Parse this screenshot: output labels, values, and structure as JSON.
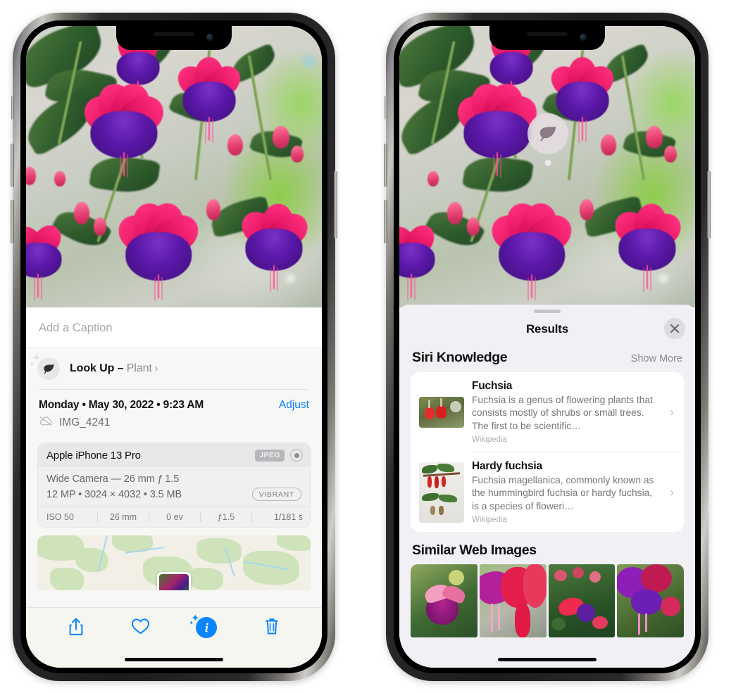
{
  "colors": {
    "accent_blue": "#0a84ff",
    "sheet_gray": "#f1f0f5",
    "card_white": "#ffffff",
    "muted_text": "#8e8e93"
  },
  "left_phone": {
    "name": "photos-detail-screen",
    "caption": {
      "placeholder": "Add a Caption",
      "value": ""
    },
    "lookup": {
      "icon": "leaf-icon",
      "label": "Look Up – ",
      "subject": "Plant",
      "chevron": "›"
    },
    "date": {
      "text": "Monday • May 30, 2022 • 9:23 AM",
      "adjust_label": "Adjust",
      "cloud_icon": "icloud-slash-icon",
      "filename": "IMG_4241"
    },
    "exif": {
      "device": "Apple iPhone 13 Pro",
      "format_badge": "JPEG",
      "hdr_icon": "hdr-ring-icon",
      "lens": "Wide Camera — 26 mm ƒ 1.5",
      "size_line": "12 MP • 3024 × 4032 • 3.5 MB",
      "vibrant_badge": "VIBRANT",
      "stats": [
        "ISO 50",
        "26 mm",
        "0 ev",
        "ƒ1.5",
        "1/181 s"
      ]
    },
    "map": {
      "name": "location-map-thumbnail",
      "pin_label": ""
    },
    "toolbar": [
      {
        "name": "share-button",
        "icon": "share-icon"
      },
      {
        "name": "favorite-button",
        "icon": "heart-icon"
      },
      {
        "name": "info-button",
        "icon": "info-sparkle-icon",
        "glyph": "i"
      },
      {
        "name": "delete-button",
        "icon": "trash-icon"
      }
    ]
  },
  "right_phone": {
    "name": "visual-lookup-results-screen",
    "photo_badge": {
      "name": "plant-lookup-badge",
      "icon": "leaf-icon"
    },
    "sheet": {
      "grabber": "drag-handle",
      "title": "Results",
      "close_label": "✕"
    },
    "siri_knowledge": {
      "title": "Siri Knowledge",
      "show_more": "Show More",
      "items": [
        {
          "title": "Fuchsia",
          "description": "Fuchsia is a genus of flowering plants that consists mostly of shrubs or small trees. The first to be scientific…",
          "source": "Wikipedia",
          "chevron": "›"
        },
        {
          "title": "Hardy fuchsia",
          "description": "Fuchsia magellanica, commonly known as the hummingbird fuchsia or hardy fuchsia, is a species of floweri…",
          "source": "Wikipedia",
          "chevron": "›"
        }
      ]
    },
    "similar_web_images": {
      "title": "Similar Web Images",
      "count": 4
    }
  }
}
